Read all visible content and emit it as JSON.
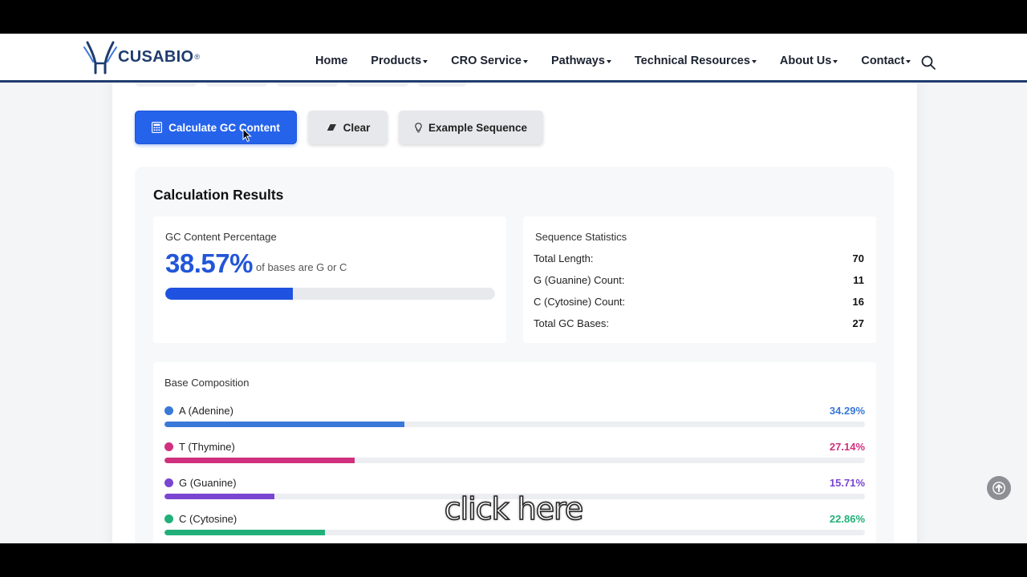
{
  "header": {
    "logo_text": "CUSABIO",
    "logo_reg": "®",
    "nav": [
      {
        "label": "Home",
        "dropdown": false
      },
      {
        "label": "Products",
        "dropdown": true
      },
      {
        "label": "CRO Service",
        "dropdown": true
      },
      {
        "label": "Pathways",
        "dropdown": true
      },
      {
        "label": "Technical Resources",
        "dropdown": true
      },
      {
        "label": "About Us",
        "dropdown": true
      },
      {
        "label": "Contact",
        "dropdown": true
      }
    ],
    "search_icon": "search-icon"
  },
  "actions": {
    "calculate_label": "Calculate GC Content",
    "clear_label": "Clear",
    "example_label": "Example Sequence"
  },
  "results": {
    "title": "Calculation Results",
    "gc": {
      "label": "GC Content Percentage",
      "value": "38.57%",
      "subtext": "of bases are G or C",
      "fraction": 0.3857
    },
    "stats": {
      "label": "Sequence Statistics",
      "rows": [
        {
          "label": "Total Length:",
          "value": "70"
        },
        {
          "label": "G (Guanine) Count:",
          "value": "11"
        },
        {
          "label": "C (Cytosine) Count:",
          "value": "16"
        },
        {
          "label": "Total GC Bases:",
          "value": "27"
        }
      ]
    },
    "composition": {
      "label": "Base Composition",
      "bases": [
        {
          "name": "A (Adenine)",
          "pct": "34.29%",
          "fraction": 0.3429,
          "color": "#3a78d8"
        },
        {
          "name": "T (Thymine)",
          "pct": "27.14%",
          "fraction": 0.2714,
          "color": "#d0307d"
        },
        {
          "name": "G (Guanine)",
          "pct": "15.71%",
          "fraction": 0.1571,
          "color": "#7a45d1"
        },
        {
          "name": "C (Cytosine)",
          "pct": "22.86%",
          "fraction": 0.2286,
          "color": "#22b07a"
        }
      ]
    }
  },
  "overlay": {
    "caption": "click here"
  }
}
